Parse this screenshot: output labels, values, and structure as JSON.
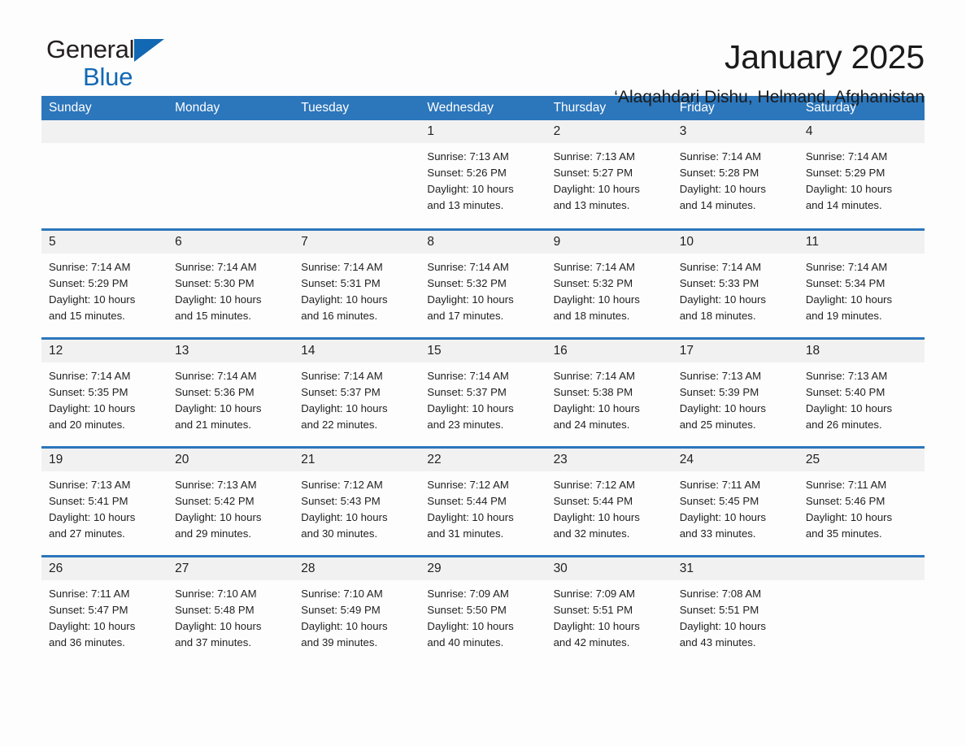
{
  "brand": {
    "word_one": "General",
    "word_two": "Blue",
    "triangle_color": "#1268b3",
    "logo_icon": "triangle-icon"
  },
  "header": {
    "title": "January 2025",
    "subtitle": "‘Alaqahdari Dishu, Helmand, Afghanistan"
  },
  "calendar": {
    "header_bg": "#2c76bb",
    "row_border": "#2c76bb",
    "daynum_bg": "#f1f1f1",
    "weekdays": [
      "Sunday",
      "Monday",
      "Tuesday",
      "Wednesday",
      "Thursday",
      "Friday",
      "Saturday"
    ],
    "weeks": [
      [
        {
          "day": "",
          "sunrise": "",
          "sunset": "",
          "daylight_line1": "",
          "daylight_line2": "",
          "empty": true
        },
        {
          "day": "",
          "sunrise": "",
          "sunset": "",
          "daylight_line1": "",
          "daylight_line2": "",
          "empty": true
        },
        {
          "day": "",
          "sunrise": "",
          "sunset": "",
          "daylight_line1": "",
          "daylight_line2": "",
          "empty": true
        },
        {
          "day": "1",
          "sunrise": "Sunrise: 7:13 AM",
          "sunset": "Sunset: 5:26 PM",
          "daylight_line1": "Daylight: 10 hours",
          "daylight_line2": "and 13 minutes."
        },
        {
          "day": "2",
          "sunrise": "Sunrise: 7:13 AM",
          "sunset": "Sunset: 5:27 PM",
          "daylight_line1": "Daylight: 10 hours",
          "daylight_line2": "and 13 minutes."
        },
        {
          "day": "3",
          "sunrise": "Sunrise: 7:14 AM",
          "sunset": "Sunset: 5:28 PM",
          "daylight_line1": "Daylight: 10 hours",
          "daylight_line2": "and 14 minutes."
        },
        {
          "day": "4",
          "sunrise": "Sunrise: 7:14 AM",
          "sunset": "Sunset: 5:29 PM",
          "daylight_line1": "Daylight: 10 hours",
          "daylight_line2": "and 14 minutes."
        }
      ],
      [
        {
          "day": "5",
          "sunrise": "Sunrise: 7:14 AM",
          "sunset": "Sunset: 5:29 PM",
          "daylight_line1": "Daylight: 10 hours",
          "daylight_line2": "and 15 minutes."
        },
        {
          "day": "6",
          "sunrise": "Sunrise: 7:14 AM",
          "sunset": "Sunset: 5:30 PM",
          "daylight_line1": "Daylight: 10 hours",
          "daylight_line2": "and 15 minutes."
        },
        {
          "day": "7",
          "sunrise": "Sunrise: 7:14 AM",
          "sunset": "Sunset: 5:31 PM",
          "daylight_line1": "Daylight: 10 hours",
          "daylight_line2": "and 16 minutes."
        },
        {
          "day": "8",
          "sunrise": "Sunrise: 7:14 AM",
          "sunset": "Sunset: 5:32 PM",
          "daylight_line1": "Daylight: 10 hours",
          "daylight_line2": "and 17 minutes."
        },
        {
          "day": "9",
          "sunrise": "Sunrise: 7:14 AM",
          "sunset": "Sunset: 5:32 PM",
          "daylight_line1": "Daylight: 10 hours",
          "daylight_line2": "and 18 minutes."
        },
        {
          "day": "10",
          "sunrise": "Sunrise: 7:14 AM",
          "sunset": "Sunset: 5:33 PM",
          "daylight_line1": "Daylight: 10 hours",
          "daylight_line2": "and 18 minutes."
        },
        {
          "day": "11",
          "sunrise": "Sunrise: 7:14 AM",
          "sunset": "Sunset: 5:34 PM",
          "daylight_line1": "Daylight: 10 hours",
          "daylight_line2": "and 19 minutes."
        }
      ],
      [
        {
          "day": "12",
          "sunrise": "Sunrise: 7:14 AM",
          "sunset": "Sunset: 5:35 PM",
          "daylight_line1": "Daylight: 10 hours",
          "daylight_line2": "and 20 minutes."
        },
        {
          "day": "13",
          "sunrise": "Sunrise: 7:14 AM",
          "sunset": "Sunset: 5:36 PM",
          "daylight_line1": "Daylight: 10 hours",
          "daylight_line2": "and 21 minutes."
        },
        {
          "day": "14",
          "sunrise": "Sunrise: 7:14 AM",
          "sunset": "Sunset: 5:37 PM",
          "daylight_line1": "Daylight: 10 hours",
          "daylight_line2": "and 22 minutes."
        },
        {
          "day": "15",
          "sunrise": "Sunrise: 7:14 AM",
          "sunset": "Sunset: 5:37 PM",
          "daylight_line1": "Daylight: 10 hours",
          "daylight_line2": "and 23 minutes."
        },
        {
          "day": "16",
          "sunrise": "Sunrise: 7:14 AM",
          "sunset": "Sunset: 5:38 PM",
          "daylight_line1": "Daylight: 10 hours",
          "daylight_line2": "and 24 minutes."
        },
        {
          "day": "17",
          "sunrise": "Sunrise: 7:13 AM",
          "sunset": "Sunset: 5:39 PM",
          "daylight_line1": "Daylight: 10 hours",
          "daylight_line2": "and 25 minutes."
        },
        {
          "day": "18",
          "sunrise": "Sunrise: 7:13 AM",
          "sunset": "Sunset: 5:40 PM",
          "daylight_line1": "Daylight: 10 hours",
          "daylight_line2": "and 26 minutes."
        }
      ],
      [
        {
          "day": "19",
          "sunrise": "Sunrise: 7:13 AM",
          "sunset": "Sunset: 5:41 PM",
          "daylight_line1": "Daylight: 10 hours",
          "daylight_line2": "and 27 minutes."
        },
        {
          "day": "20",
          "sunrise": "Sunrise: 7:13 AM",
          "sunset": "Sunset: 5:42 PM",
          "daylight_line1": "Daylight: 10 hours",
          "daylight_line2": "and 29 minutes."
        },
        {
          "day": "21",
          "sunrise": "Sunrise: 7:12 AM",
          "sunset": "Sunset: 5:43 PM",
          "daylight_line1": "Daylight: 10 hours",
          "daylight_line2": "and 30 minutes."
        },
        {
          "day": "22",
          "sunrise": "Sunrise: 7:12 AM",
          "sunset": "Sunset: 5:44 PM",
          "daylight_line1": "Daylight: 10 hours",
          "daylight_line2": "and 31 minutes."
        },
        {
          "day": "23",
          "sunrise": "Sunrise: 7:12 AM",
          "sunset": "Sunset: 5:44 PM",
          "daylight_line1": "Daylight: 10 hours",
          "daylight_line2": "and 32 minutes."
        },
        {
          "day": "24",
          "sunrise": "Sunrise: 7:11 AM",
          "sunset": "Sunset: 5:45 PM",
          "daylight_line1": "Daylight: 10 hours",
          "daylight_line2": "and 33 minutes."
        },
        {
          "day": "25",
          "sunrise": "Sunrise: 7:11 AM",
          "sunset": "Sunset: 5:46 PM",
          "daylight_line1": "Daylight: 10 hours",
          "daylight_line2": "and 35 minutes."
        }
      ],
      [
        {
          "day": "26",
          "sunrise": "Sunrise: 7:11 AM",
          "sunset": "Sunset: 5:47 PM",
          "daylight_line1": "Daylight: 10 hours",
          "daylight_line2": "and 36 minutes."
        },
        {
          "day": "27",
          "sunrise": "Sunrise: 7:10 AM",
          "sunset": "Sunset: 5:48 PM",
          "daylight_line1": "Daylight: 10 hours",
          "daylight_line2": "and 37 minutes."
        },
        {
          "day": "28",
          "sunrise": "Sunrise: 7:10 AM",
          "sunset": "Sunset: 5:49 PM",
          "daylight_line1": "Daylight: 10 hours",
          "daylight_line2": "and 39 minutes."
        },
        {
          "day": "29",
          "sunrise": "Sunrise: 7:09 AM",
          "sunset": "Sunset: 5:50 PM",
          "daylight_line1": "Daylight: 10 hours",
          "daylight_line2": "and 40 minutes."
        },
        {
          "day": "30",
          "sunrise": "Sunrise: 7:09 AM",
          "sunset": "Sunset: 5:51 PM",
          "daylight_line1": "Daylight: 10 hours",
          "daylight_line2": "and 42 minutes."
        },
        {
          "day": "31",
          "sunrise": "Sunrise: 7:08 AM",
          "sunset": "Sunset: 5:51 PM",
          "daylight_line1": "Daylight: 10 hours",
          "daylight_line2": "and 43 minutes."
        },
        {
          "day": "",
          "sunrise": "",
          "sunset": "",
          "daylight_line1": "",
          "daylight_line2": "",
          "empty": true
        }
      ]
    ]
  }
}
